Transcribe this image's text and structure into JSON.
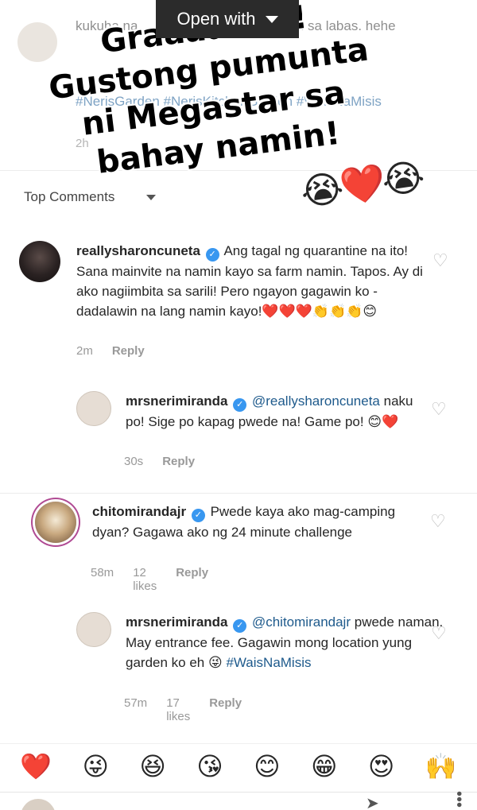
{
  "top_button": {
    "label": "Open with"
  },
  "top_post": {
    "text": "kukuha na ... ng saging at dun ... kami sa labas. hehe",
    "hashtags": "#NerisGarden #NerisKitchenGarden #WaisNaMisis",
    "time": "2h"
  },
  "sort": {
    "label": "Top Comments"
  },
  "overlay": {
    "text": "Graaaaabe! Gustong pumunta ni Megastar sa bahay namin!",
    "emoji": "😭❤️😭"
  },
  "comments": [
    {
      "user": "reallysharoncuneta",
      "text": "Ang tagal ng quarantine na ito! Sana mainvite na namin kayo sa farm namin. Tapos. Ay di ako nagiimbita sa sarili! Pero ngayon gagawin ko - dadalawin na lang namin kayo!❤️❤️❤️👏👏👏😊",
      "time": "2m",
      "reply": "Reply"
    },
    {
      "user": "mrsnerimiranda",
      "mention": "@reallysharoncuneta",
      "text": "naku po! Sige po kapag pwede na! Game po! 😊❤️",
      "time": "30s",
      "reply": "Reply"
    },
    {
      "user": "chitomirandajr",
      "text": "Pwede kaya ako mag-camping dyan? Gagawa ako ng 24 minute challenge",
      "time": "58m",
      "likes": "12 likes",
      "reply": "Reply"
    },
    {
      "user": "mrsnerimiranda",
      "mention": "@chitomirandajr",
      "text": "pwede naman. May entrance fee. Gagawin mong location yung garden ko eh 😜",
      "hashtag": "#WaisNaMisis",
      "time": "57m",
      "likes": "17 likes",
      "reply": "Reply"
    }
  ],
  "reactions": [
    "❤️",
    "😜",
    "😆",
    "😘",
    "😊",
    "😁",
    "😍",
    "🙌"
  ],
  "icons": {
    "verified": "✓",
    "heart_outline": "♡",
    "send": "➤",
    "more": "•••"
  }
}
